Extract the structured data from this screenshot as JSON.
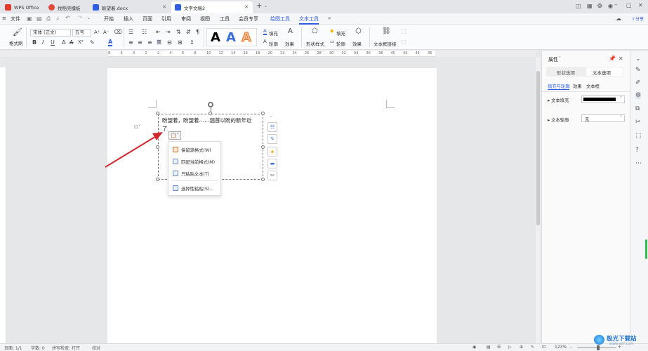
{
  "titlebar": {
    "tabs": [
      {
        "label": "WPS Office",
        "icon": "wps-logo-icon"
      },
      {
        "label": "找稻壳模板",
        "icon": "docer-icon"
      },
      {
        "label": "盼望着.docx",
        "icon": "word-doc-icon"
      },
      {
        "label": "文字文稿2",
        "icon": "word-doc-icon"
      }
    ]
  },
  "menubar": {
    "file": "文件",
    "items": [
      "开始",
      "插入",
      "页面",
      "引用",
      "审阅",
      "视图",
      "工具",
      "会员专享",
      "绘图工具",
      "文本工具"
    ]
  },
  "ribbon": {
    "format_painter": "格式刷",
    "font_name": "宋体 (正文)",
    "font_size": "五号",
    "text_fill": "填充",
    "text_outline": "轮廓",
    "text_effect": "效果",
    "shape_style": "形状样式",
    "shape_fill": "填充",
    "shape_outline": "轮廓",
    "shape_effect": "效果",
    "textbox_link": "文本框链接",
    "art_letters": [
      "A",
      "A",
      "A"
    ]
  },
  "ruler": {
    "marks": [
      "8",
      "6",
      "4",
      "2",
      "2",
      "4",
      "6",
      "8",
      "10",
      "12",
      "14",
      "16",
      "18",
      "20",
      "22",
      "24",
      "26",
      "28",
      "30",
      "32",
      "34",
      "36",
      "38",
      "40",
      "42",
      "44",
      "46"
    ]
  },
  "document": {
    "textbox_line1": "盼望着，盼望着……翘首以盼的新年近",
    "textbox_line2": "了"
  },
  "paste_menu": {
    "items": [
      "保留源格式(W)",
      "匹配当前格式(M)",
      "只粘贴文本(T)",
      "选择性粘贴(S)..."
    ]
  },
  "panel": {
    "title": "属性",
    "tabs": [
      "形状选项",
      "文本选项"
    ],
    "subtabs": [
      "填充与轮廓",
      "效果",
      "文本框"
    ],
    "fill_label": "文本填充",
    "outline_label": "文本轮廓",
    "outline_value": "无"
  },
  "statusbar": {
    "page": "页面: 1/1",
    "words": "字数: 0",
    "spellcheck": "拼写检查: 打开",
    "proofread": "校对",
    "zoom": "123%"
  },
  "watermark": "极光下载站",
  "colors": {
    "accent": "#2e5de1",
    "arrow": "#d0282e",
    "fill_swatch": "#000000"
  }
}
